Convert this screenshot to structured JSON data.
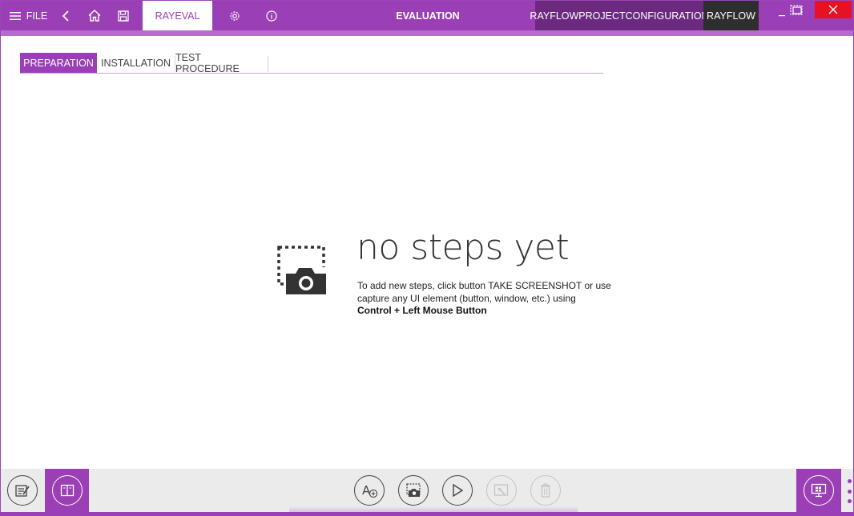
{
  "titlebar": {
    "file_label": "FILE",
    "active_tab_label": "RAYEVAL",
    "title": "EVALUATION",
    "project_config_label": "RAYFLOWPROJECTCONFIGURATION",
    "rayflow_label": "RAYFLOW",
    "icons": [
      "menu-icon",
      "back-icon",
      "home-icon",
      "save-icon",
      "settings-icon",
      "info-icon",
      "minimize-icon",
      "maximize-icon",
      "close-icon"
    ]
  },
  "subtabs": [
    {
      "label": "PREPARATION",
      "active": true
    },
    {
      "label": "INSTALLATION",
      "active": false
    },
    {
      "label": "TEST PROCEDURE",
      "active": false
    }
  ],
  "empty_state": {
    "title": "no steps yet",
    "description": "To add new steps, click button TAKE SCREENSHOT or use capture any UI element (button, window, etc.) using",
    "shortcut": "Control + Left Mouse Button"
  },
  "toolbar": {
    "icons": [
      "notes-icon",
      "split-view-icon",
      "add-text-step-icon",
      "take-screenshot-icon",
      "play-icon",
      "edit-screenshot-icon",
      "delete-icon",
      "remote-desktop-icon",
      "more-options-icon"
    ]
  },
  "colors": {
    "accent": "#9a3fb5",
    "accent_dark": "#6b2a80",
    "accent_light": "#b76bd0",
    "rayflow_bg": "#2e2e2e",
    "close_red": "#e81123",
    "toolbar_bg": "#ebebeb"
  }
}
